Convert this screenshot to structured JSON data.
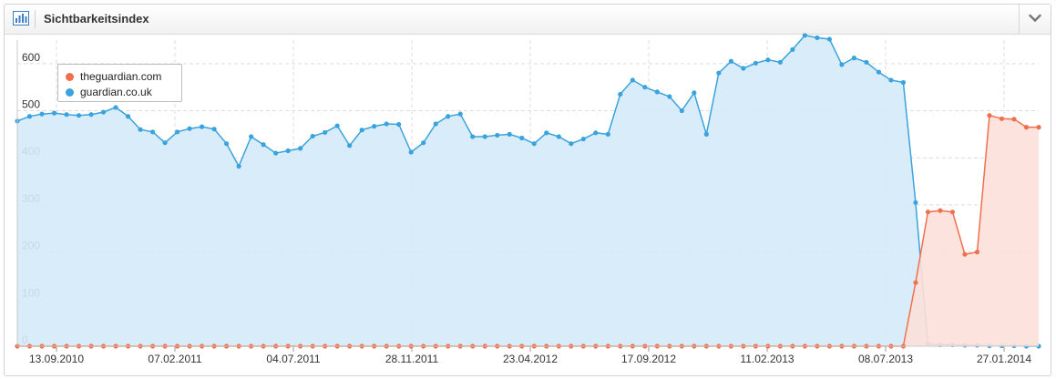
{
  "header": {
    "title": "Sichtbarkeitsindex",
    "icon": "bar-chart-icon",
    "collapse_icon": "chevron-down-icon"
  },
  "colors": {
    "orange": "#f0704e",
    "orange_fill": "#fde0d9",
    "blue": "#3aa3dd",
    "blue_fill": "#d4ebf8",
    "grid": "#dcdcdc"
  },
  "chart_data": {
    "type": "area",
    "title": "Sichtbarkeitsindex",
    "xlabel": "",
    "ylabel": "",
    "ylim": [
      0,
      650
    ],
    "yticks": [
      0,
      100,
      200,
      300,
      400,
      500,
      600
    ],
    "xticks": [
      "13.09.2010",
      "07.02.2011",
      "04.07.2011",
      "28.11.2011",
      "23.04.2012",
      "17.09.2012",
      "11.02.2013",
      "08.07.2013",
      "27.01.2014"
    ],
    "x_points": 76,
    "grid": true,
    "legend_position": "top-left",
    "series": [
      {
        "name": "guardian.co.uk",
        "color": "#3aa3dd",
        "values": [
          478,
          488,
          493,
          495,
          492,
          490,
          492,
          497,
          507,
          488,
          460,
          455,
          432,
          455,
          462,
          466,
          461,
          430,
          382,
          445,
          428,
          410,
          415,
          420,
          446,
          454,
          468,
          426,
          459,
          467,
          472,
          471,
          412,
          432,
          472,
          488,
          493,
          445,
          445,
          448,
          450,
          442,
          430,
          453,
          445,
          430,
          440,
          453,
          450,
          535,
          565,
          550,
          540,
          530,
          500,
          538,
          450,
          580,
          605,
          590,
          601,
          608,
          603,
          630,
          660,
          655,
          652,
          598,
          612,
          603,
          582,
          565,
          560,
          305,
          5,
          3,
          3,
          2,
          2,
          1,
          1,
          1,
          0,
          0
        ]
      },
      {
        "name": "theguardian.com",
        "color": "#f0704e",
        "values": [
          0,
          0,
          0,
          0,
          0,
          0,
          0,
          0,
          0,
          0,
          0,
          0,
          0,
          0,
          0,
          0,
          0,
          0,
          0,
          0,
          0,
          0,
          0,
          0,
          0,
          0,
          0,
          0,
          0,
          0,
          0,
          0,
          0,
          0,
          0,
          0,
          0,
          0,
          0,
          0,
          0,
          0,
          0,
          0,
          0,
          0,
          0,
          0,
          0,
          0,
          0,
          0,
          0,
          0,
          0,
          0,
          0,
          0,
          0,
          0,
          0,
          0,
          0,
          0,
          0,
          0,
          0,
          0,
          0,
          0,
          0,
          0,
          0,
          135,
          285,
          288,
          285,
          195,
          200,
          490,
          483,
          482,
          465,
          465
        ]
      }
    ]
  }
}
